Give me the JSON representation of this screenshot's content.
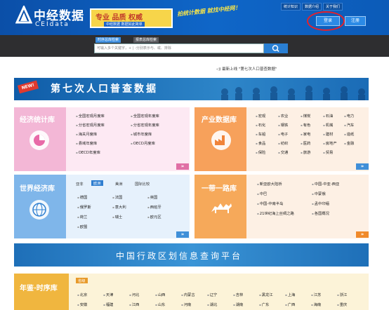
{
  "header": {
    "logo_cn": "中经数据",
    "logo_en": "CEIdata",
    "banner_slogan": "专业 品质 权威",
    "banner_sub": "中经数据 数据如此简单",
    "tagline": "拍统计数据 就找中经网！",
    "top_links": [
      "统计知识",
      "数据介绍",
      "关于我们"
    ],
    "login_label": "登录",
    "register_label": "注册"
  },
  "search": {
    "tabs": [
      "时序总库检索",
      "报表总库检索"
    ],
    "placeholder": "可输入多个关键字，+ | -分别表示与、或、排除"
  },
  "news": {
    "text": "最新上线 \"第七次人口普查数据\""
  },
  "census": {
    "badge": "NEW!",
    "title": "第七次人口普查数据"
  },
  "econ": {
    "title": "经济统计库",
    "left": [
      "全国宏观月度库",
      "分省宏观月度库",
      "海关月度库",
      "县域年度库",
      "OECD年度库"
    ],
    "right": [
      "全国宏观年度库",
      "分省宏观年度库",
      "城市年度库",
      "OECD月度库"
    ]
  },
  "industry": {
    "title": "产业数据库",
    "rows": [
      [
        "宏观",
        "农业",
        "煤炭",
        "石油",
        "电力"
      ],
      [
        "石化",
        "钢铁",
        "有色",
        "机械",
        "汽车"
      ],
      [
        "车船",
        "电子",
        "家电",
        "建材",
        "造纸"
      ],
      [
        "食品",
        "纺织",
        "医药",
        "房地产",
        "金融"
      ],
      [
        "保险",
        "交通",
        "旅游",
        "贸易"
      ]
    ]
  },
  "world": {
    "title": "世界经济库",
    "tabs": [
      "亚非",
      "欧洲",
      "美洲",
      "国际比较"
    ],
    "rows": [
      [
        "德国",
        "法国",
        "英国"
      ],
      [
        "俄罗斯",
        "意大利",
        "西班牙"
      ],
      [
        "荷兰",
        "瑞士",
        "欧元区"
      ],
      [
        "欧盟"
      ]
    ]
  },
  "belt": {
    "title": "一带一路库",
    "left": [
      "新亚欧大陆桥",
      "中巴",
      "中国-中南半岛",
      "21世纪海上丝绸之路"
    ],
    "right": [
      "中国-中亚-西亚",
      "中蒙俄",
      "孟中印缅",
      "各国概况"
    ]
  },
  "admin": {
    "title": "中国行政区划信息查询平台"
  },
  "almanac": {
    "title": "年鉴·时序库",
    "tab": "省级",
    "row1": [
      "北京",
      "天津",
      "河北",
      "山西",
      "内蒙古",
      "辽宁",
      "吉林",
      "黑龙江",
      "上海",
      "江苏",
      "浙江"
    ],
    "row2": [
      "安徽",
      "福建",
      "江西",
      "山东",
      "河南",
      "湖北",
      "湖南",
      "广东",
      "广西",
      "海南",
      "重庆"
    ]
  },
  "colors": {
    "econ": "#f3b7d6",
    "industry": "#f7a15b",
    "world": "#7fb6ea",
    "belt": "#f6a95a"
  }
}
